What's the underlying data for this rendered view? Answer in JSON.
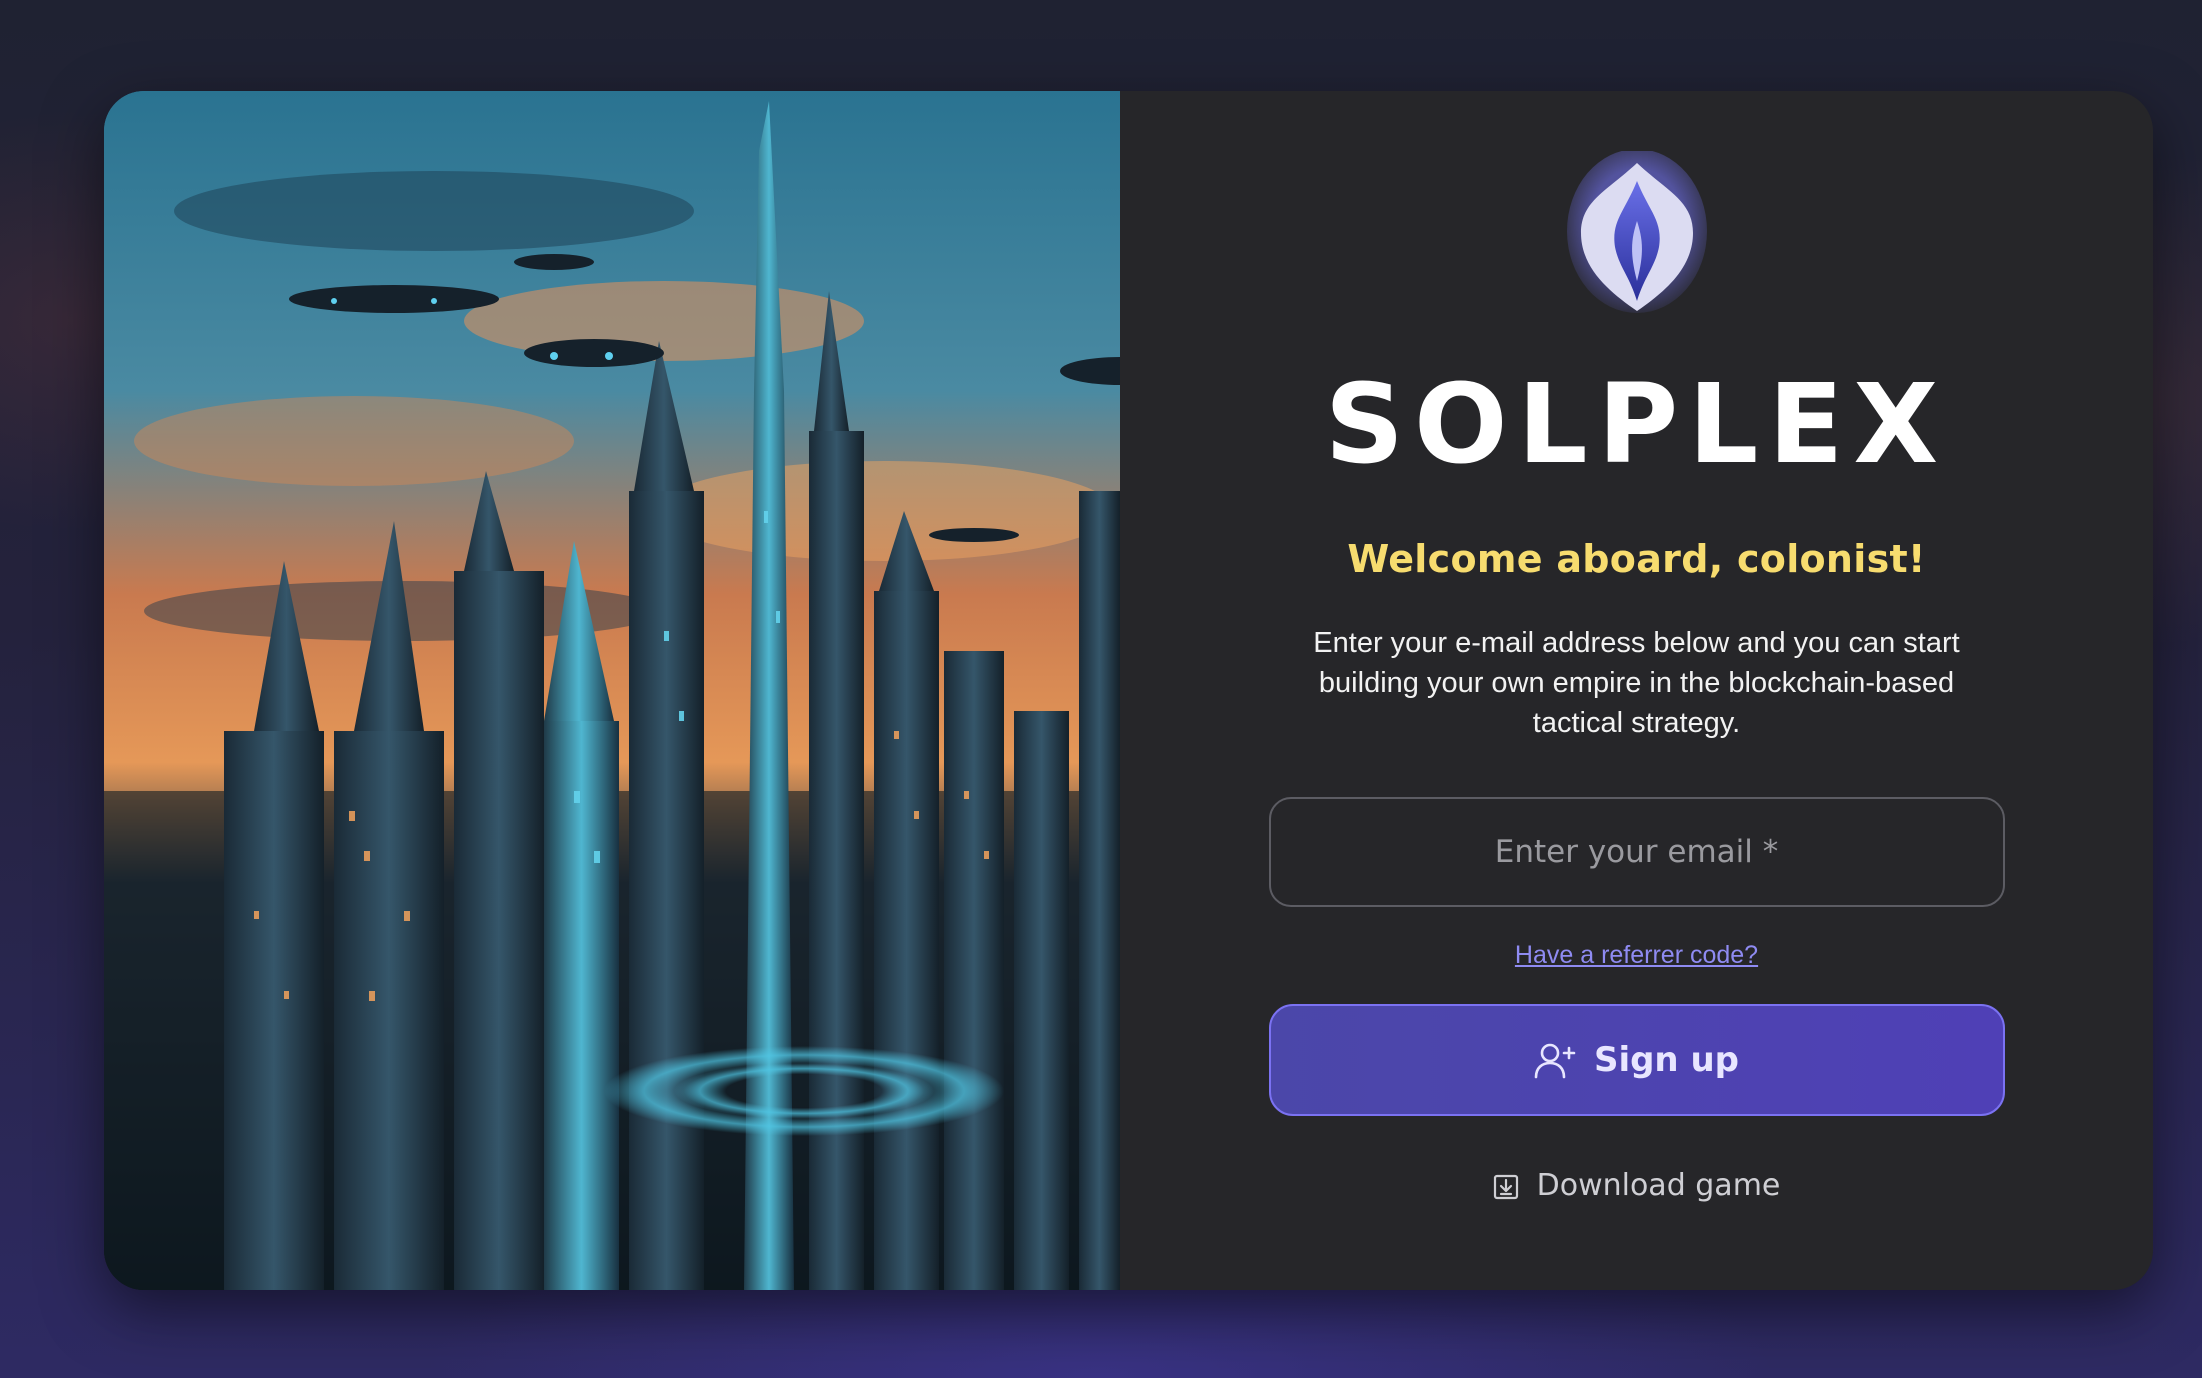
{
  "brand": {
    "name": "SOLPLEX",
    "logo_icon": "flame-shield-icon"
  },
  "welcome": {
    "heading": "Welcome aboard, colonist!",
    "description": "Enter your e-mail address below and you can start building your own empire in the blockchain-based tactical strategy."
  },
  "form": {
    "email_placeholder": "Enter your email *",
    "referrer_link": "Have a referrer code?",
    "signup_label": "Sign up",
    "signup_icon": "user-plus-icon"
  },
  "download": {
    "label": "Download game",
    "icon": "download-icon"
  },
  "colors": {
    "accent": "#4f40b6",
    "welcome": "#f7dc6f",
    "link": "#8f8bf2",
    "card_bg": "#262629"
  }
}
